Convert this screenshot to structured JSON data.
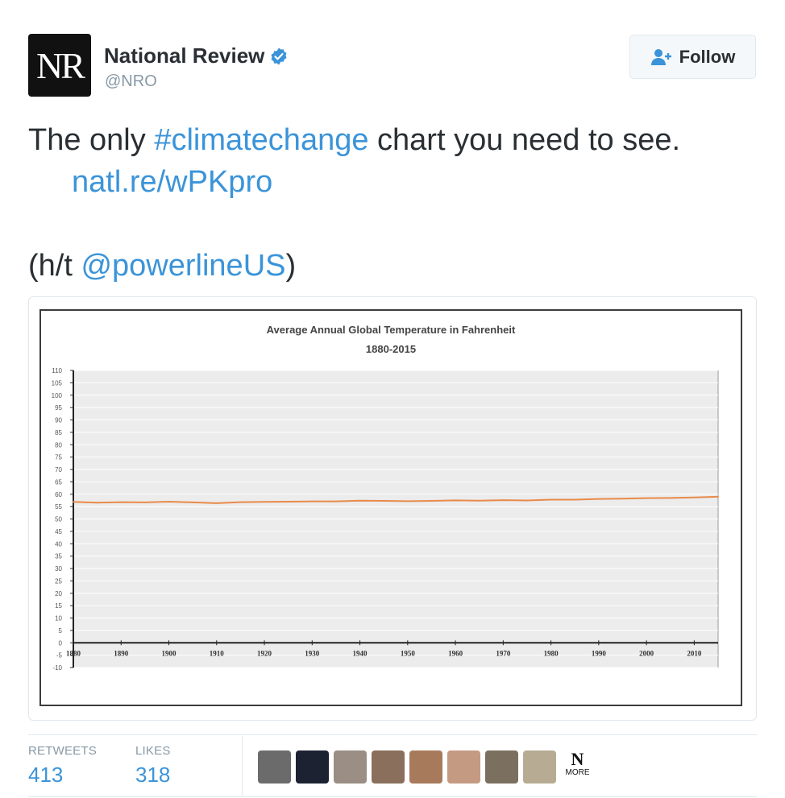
{
  "tweet": {
    "author": {
      "name": "National Review",
      "handle": "@NRO",
      "avatar_text": "NR",
      "verified_icon": "verified-badge-icon"
    },
    "follow_label": "Follow",
    "text_plain_1": "The only ",
    "hashtag": "#climatechange",
    "text_plain_2": " chart you need to see.",
    "link": "natl.re/wPKpro",
    "ht_prefix": "(h/t ",
    "mention": "@powerlineUS",
    "ht_suffix": ")"
  },
  "stats": {
    "retweets_label": "RETWEETS",
    "retweets": "413",
    "likes_label": "LIKES",
    "likes": "318"
  },
  "likers": {
    "count": 9,
    "last_badge_top": "N",
    "last_badge_bottom": "MORE",
    "colors": [
      "#6b6b6b",
      "#1d2233",
      "#9a8e85",
      "#8a6f5c",
      "#a87a5c",
      "#c49a82",
      "#7b6f5f",
      "#b8ab94"
    ]
  },
  "colors": {
    "link": "#3b94d9",
    "line": "#e98a4a"
  },
  "chart_data": {
    "type": "line",
    "title": "Average Annual Global Temperature in Fahrenheit",
    "subtitle": "1880-2015",
    "xlim": [
      1880,
      2015
    ],
    "ylim": [
      -10,
      110
    ],
    "xticks": [
      "1880",
      "1890",
      "1900",
      "1910",
      "1920",
      "1930",
      "1940",
      "1950",
      "1960",
      "1970",
      "1980",
      "1990",
      "2000",
      "2010"
    ],
    "yticks": [
      "-10",
      "-5",
      "0",
      "5",
      "10",
      "15",
      "20",
      "25",
      "30",
      "35",
      "40",
      "45",
      "50",
      "55",
      "60",
      "65",
      "70",
      "75",
      "80",
      "85",
      "90",
      "95",
      "100",
      "105",
      "110"
    ],
    "grid": true,
    "series": [
      {
        "x": [
          1880,
          1885,
          1890,
          1895,
          1900,
          1905,
          1910,
          1915,
          1920,
          1925,
          1930,
          1935,
          1940,
          1945,
          1950,
          1955,
          1960,
          1965,
          1970,
          1975,
          1980,
          1985,
          1990,
          1995,
          2000,
          2005,
          2010,
          2015
        ],
        "values": [
          56.9,
          56.6,
          56.8,
          56.7,
          57.0,
          56.7,
          56.4,
          56.8,
          56.9,
          57.0,
          57.1,
          57.1,
          57.4,
          57.3,
          57.2,
          57.3,
          57.5,
          57.4,
          57.6,
          57.5,
          57.8,
          57.8,
          58.1,
          58.2,
          58.4,
          58.5,
          58.7,
          59.0
        ]
      }
    ]
  }
}
